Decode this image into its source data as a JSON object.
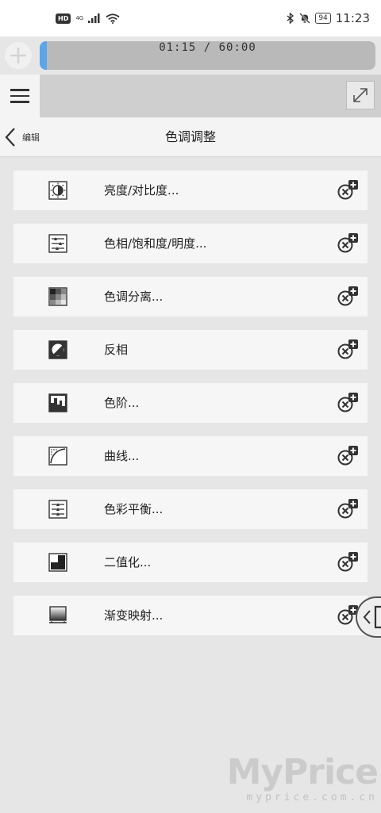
{
  "status_bar": {
    "hd": "HD",
    "network": "4G",
    "time": "11:23",
    "battery": "94"
  },
  "recording": {
    "timer": "01:15 / 60:00",
    "progress": 0.0208
  },
  "panel": {
    "back_label": "编辑",
    "title": "色调调整"
  },
  "items": [
    {
      "label": "亮度/对比度...",
      "icon": "brightness-contrast-icon"
    },
    {
      "label": "色相/饱和度/明度...",
      "icon": "hue-saturation-icon"
    },
    {
      "label": "色调分离...",
      "icon": "posterize-icon"
    },
    {
      "label": "反相",
      "icon": "invert-icon"
    },
    {
      "label": "色阶...",
      "icon": "levels-icon"
    },
    {
      "label": "曲线...",
      "icon": "curves-icon"
    },
    {
      "label": "色彩平衡...",
      "icon": "color-balance-icon"
    },
    {
      "label": "二值化...",
      "icon": "binarize-icon"
    },
    {
      "label": "渐变映射...",
      "icon": "gradient-map-icon"
    }
  ],
  "watermark": {
    "main": "MyPrice",
    "sub": "myprice.com.cn"
  },
  "colors": {
    "progress": "#5aa6e8",
    "item_bg": "#f6f6f6",
    "panel_bg": "#e6e6e6"
  }
}
